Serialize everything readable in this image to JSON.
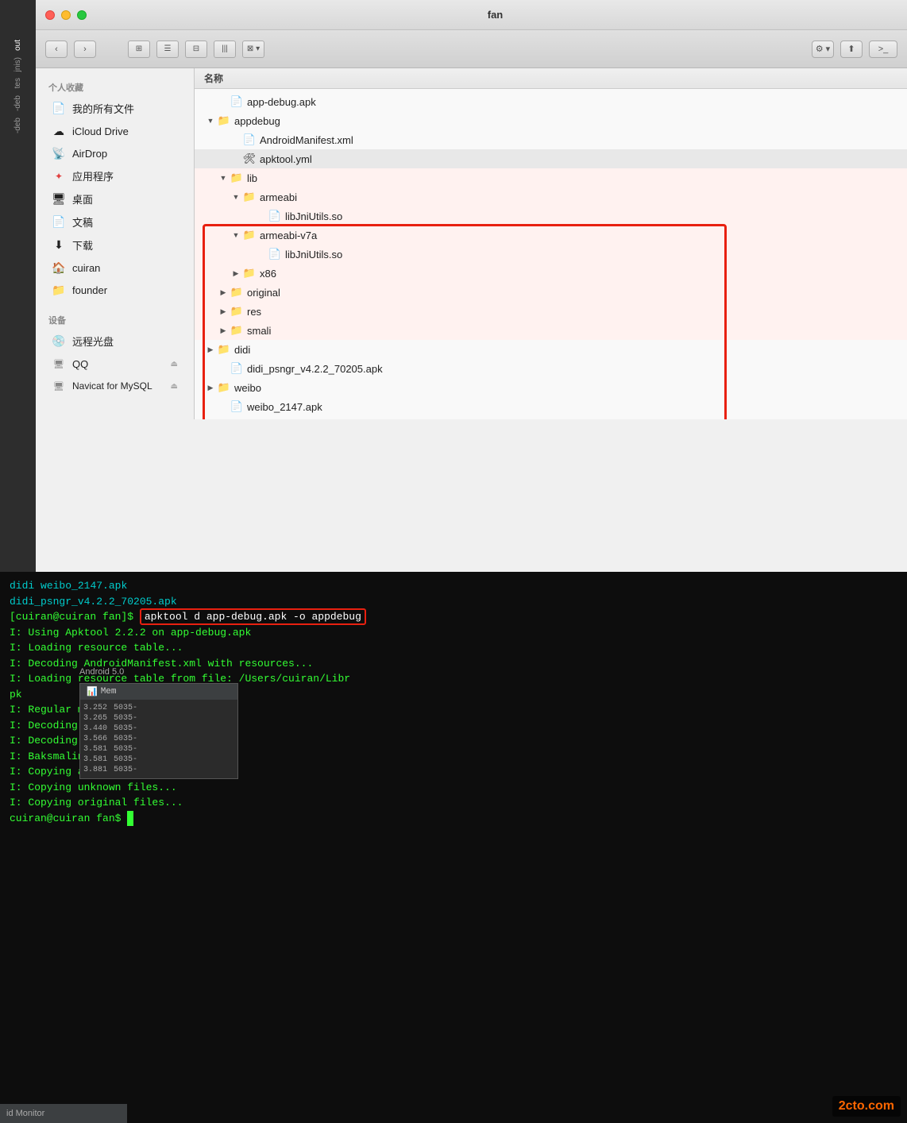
{
  "window": {
    "title": "fan",
    "traffic_lights": [
      "close",
      "minimize",
      "maximize"
    ]
  },
  "toolbar": {
    "back_label": "‹",
    "forward_label": "›",
    "view_icons": [
      "⊞",
      "☰",
      "⊟",
      "|||",
      "⊠"
    ],
    "action_label": "⚙",
    "share_label": "⬆",
    "terminal_label": ">_"
  },
  "sidebar": {
    "section_favorites": "个人收藏",
    "section_devices": "设备",
    "items_favorites": [
      {
        "id": "all-files",
        "label": "我的所有文件",
        "icon": "📄"
      },
      {
        "id": "icloud",
        "label": "iCloud Drive",
        "icon": "☁"
      },
      {
        "id": "airdrop",
        "label": "AirDrop",
        "icon": "📡"
      },
      {
        "id": "apps",
        "label": "应用程序",
        "icon": "🅰"
      },
      {
        "id": "desktop",
        "label": "桌面",
        "icon": "🖥"
      },
      {
        "id": "documents",
        "label": "文稿",
        "icon": "📄"
      },
      {
        "id": "downloads",
        "label": "下载",
        "icon": "⬇"
      },
      {
        "id": "cuiran",
        "label": "cuiran",
        "icon": "🏠"
      },
      {
        "id": "founder",
        "label": "founder",
        "icon": "📁"
      }
    ],
    "items_devices": [
      {
        "id": "remote-disc",
        "label": "远程光盘",
        "icon": "💿"
      },
      {
        "id": "qq",
        "label": "QQ",
        "icon": "🖥",
        "eject": true
      },
      {
        "id": "navicat",
        "label": "Navicat for MySQL",
        "icon": "🖥",
        "eject": true
      }
    ]
  },
  "column_header": "名称",
  "files": [
    {
      "id": "app-debug-apk",
      "name": "app-debug.apk",
      "type": "file",
      "indent": 0,
      "disclosed": false
    },
    {
      "id": "appdebug",
      "name": "appdebug",
      "type": "folder",
      "indent": 0,
      "disclosed": true
    },
    {
      "id": "androidmanifest",
      "name": "AndroidManifest.xml",
      "type": "file",
      "indent": 1,
      "disclosed": false
    },
    {
      "id": "apktool",
      "name": "apktool.yml",
      "type": "file-special",
      "indent": 1,
      "disclosed": false
    },
    {
      "id": "lib",
      "name": "lib",
      "type": "folder",
      "indent": 1,
      "disclosed": true,
      "highlighted": true
    },
    {
      "id": "armeabi",
      "name": "armeabi",
      "type": "folder",
      "indent": 2,
      "disclosed": true,
      "highlighted": true
    },
    {
      "id": "libjniutils1",
      "name": "libJniUtils.so",
      "type": "file",
      "indent": 3,
      "disclosed": false,
      "highlighted": true
    },
    {
      "id": "armeabi-v7a",
      "name": "armeabi-v7a",
      "type": "folder",
      "indent": 2,
      "disclosed": true,
      "highlighted": true
    },
    {
      "id": "libjniutils2",
      "name": "libJniUtils.so",
      "type": "file",
      "indent": 3,
      "disclosed": false,
      "highlighted": true
    },
    {
      "id": "x86",
      "name": "x86",
      "type": "folder",
      "indent": 2,
      "disclosed": false,
      "highlighted": true
    },
    {
      "id": "original",
      "name": "original",
      "type": "folder",
      "indent": 2,
      "disclosed": false,
      "highlighted": true
    },
    {
      "id": "res",
      "name": "res",
      "type": "folder",
      "indent": 2,
      "disclosed": false,
      "highlighted": true
    },
    {
      "id": "smali",
      "name": "smali",
      "type": "folder",
      "indent": 2,
      "disclosed": false,
      "highlighted": true
    },
    {
      "id": "didi",
      "name": "didi",
      "type": "folder",
      "indent": 0,
      "disclosed": false
    },
    {
      "id": "didi-apk",
      "name": "didi_psngr_v4.2.2_70205.apk",
      "type": "file",
      "indent": 0,
      "disclosed": false
    },
    {
      "id": "weibo",
      "name": "weibo",
      "type": "folder",
      "indent": 0,
      "disclosed": false
    },
    {
      "id": "weibo-apk",
      "name": "weibo_2147.apk",
      "type": "file",
      "indent": 0,
      "disclosed": false
    }
  ],
  "terminal": {
    "lines": [
      {
        "text": "didi",
        "color": "cyan",
        "suffix": "                    weibo_2147.apk",
        "suffix_color": "cyan"
      },
      {
        "text": "didi_psngr_v4.2.2_70205.apk",
        "color": "cyan"
      },
      {
        "text": "[cuiran@cuiran fan]$ ",
        "color": "green",
        "command": "apktool d app-debug.apk -o appdebug",
        "command_highlighted": true
      },
      {
        "text": "I: Using Apktool 2.2.2 on app-debug.apk",
        "color": "green"
      },
      {
        "text": "I: Loading resource table...",
        "color": "green"
      },
      {
        "text": "I: Decoding AndroidManifest.xml with resources...",
        "color": "green"
      },
      {
        "text": "I: Loading resource table from file: /Users/cuiran/Libr",
        "color": "green"
      },
      {
        "text": "pk",
        "color": "green"
      },
      {
        "text": "I: Regular manifest package...",
        "color": "green"
      },
      {
        "text": "I: Decoding file-resources...",
        "color": "green"
      },
      {
        "text": "I: Decoding values /*/ XMLs...",
        "color": "green"
      },
      {
        "text": "I: Baksmaling classes.dex...",
        "color": "green"
      },
      {
        "text": "I: Copying assets and libs...",
        "color": "green"
      },
      {
        "text": "I: Copying unknown files...",
        "color": "green"
      },
      {
        "text": "I: Copying original files...",
        "color": "green"
      },
      {
        "text": "cuiran@cuiran fan$ ",
        "color": "green",
        "cursor": true
      }
    ]
  },
  "mem_monitor": {
    "header": "Mem",
    "rows": [
      [
        "3.252",
        "5035-"
      ],
      [
        "3.265",
        "5035-"
      ],
      [
        "3.440",
        "5035-"
      ],
      [
        "3.566",
        "5035-"
      ],
      [
        "3.581",
        "5035-"
      ],
      [
        "3.581",
        "5035-"
      ],
      [
        "3.881",
        "5035-"
      ]
    ]
  },
  "android_monitor_label": "id Monitor",
  "android_version": "Android 5.0",
  "strip_labels": [
    "out",
    "jnis)",
    "tes",
    "-deb",
    "-deb"
  ],
  "watermark": "2cto.com"
}
